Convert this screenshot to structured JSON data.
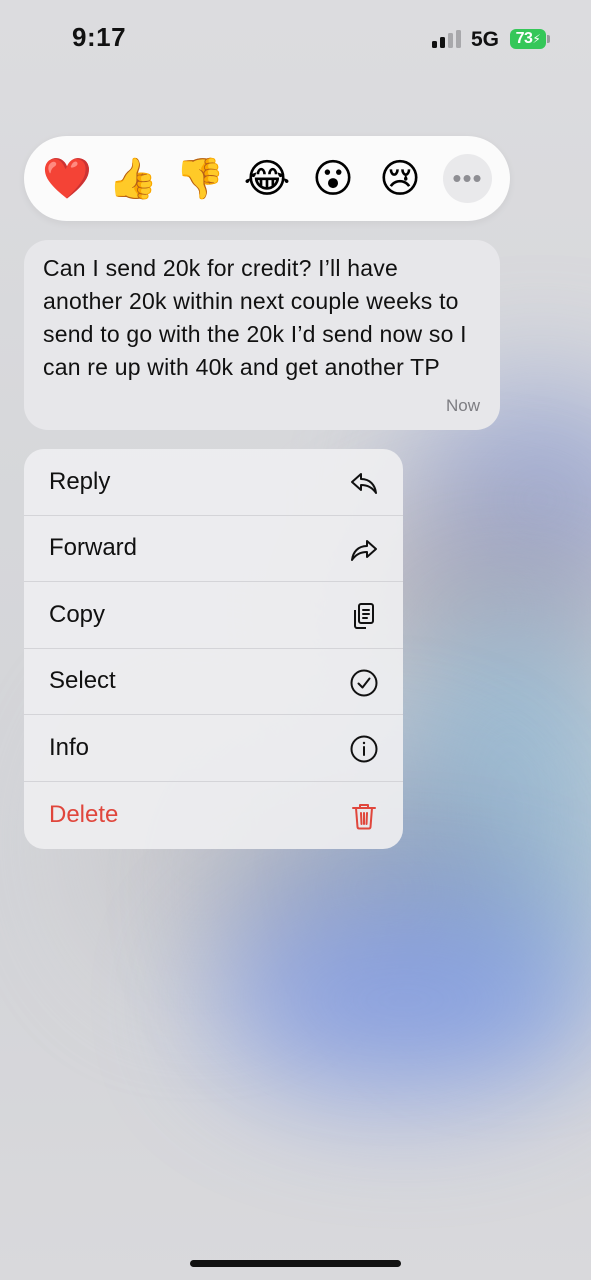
{
  "status_bar": {
    "time": "9:17",
    "network": "5G",
    "battery": "73",
    "colors": {
      "battery": "#35c759"
    }
  },
  "reactions": [
    {
      "name": "heart",
      "glyph": "❤️"
    },
    {
      "name": "thumbs-up",
      "glyph": "👍"
    },
    {
      "name": "thumbs-down",
      "glyph": "👎"
    },
    {
      "name": "laughing",
      "glyph": "😂"
    },
    {
      "name": "surprised",
      "glyph": "😮"
    },
    {
      "name": "crying",
      "glyph": "😢"
    }
  ],
  "more_reactions_label": "•••",
  "message": {
    "text": "Can I send 20k for credit? I’ll have another 20k within next couple weeks to send to go with the 20k I’d send now so I can re up with 40k and get another TP",
    "time": "Now"
  },
  "menu": {
    "items": [
      {
        "label": "Reply",
        "icon": "reply-icon"
      },
      {
        "label": "Forward",
        "icon": "forward-icon"
      },
      {
        "label": "Copy",
        "icon": "copy-icon"
      },
      {
        "label": "Select",
        "icon": "checkmark-circle-icon"
      },
      {
        "label": "Info",
        "icon": "info-icon"
      },
      {
        "label": "Delete",
        "icon": "trash-icon",
        "color": "#e0463c"
      }
    ]
  }
}
